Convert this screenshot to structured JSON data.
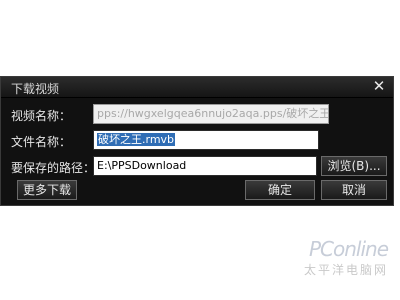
{
  "dialog": {
    "title": "下载视频",
    "close_glyph": "✕",
    "rows": {
      "name_label": "视频名称：",
      "name_value": "pps://hwgxelgqea6nnujo2aqa.pps/破坏之王.rmvb",
      "file_label": "文件名称：",
      "file_value": "破坏之王.rmvb",
      "path_label": "要保存的路径：",
      "path_value": "E:\\PPSDownload"
    },
    "buttons": {
      "browse": "浏览(B)...",
      "more": "更多下载",
      "ok": "确定",
      "cancel": "取消"
    }
  },
  "watermark": {
    "logo": "PConline",
    "sub": "太平洋电脑网"
  }
}
